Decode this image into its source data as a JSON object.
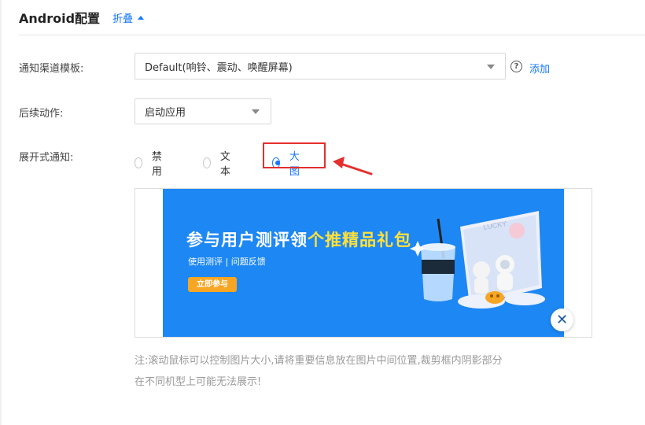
{
  "section": {
    "title": "Android配置",
    "collapse_label": "折叠"
  },
  "channel_template": {
    "label": "通知渠道模板:",
    "value": "Default(响铃、震动、唤醒屏幕)",
    "add_label": "添加",
    "help_icon": "question-circle-icon"
  },
  "follow_action": {
    "label": "后续动作:",
    "value": "启动应用"
  },
  "expand_notification": {
    "label": "展开式通知:",
    "options": [
      "禁用",
      "文本",
      "大图"
    ],
    "selected": "大图"
  },
  "banner": {
    "headline_main": "参与用户测评领",
    "headline_highlight": "个推精品礼包",
    "subline": "使用测评 | 问题反馈",
    "button": "立即参与",
    "card_text": "LUCKY",
    "close_icon": "close-icon"
  },
  "note": {
    "line1": "注:滚动鼠标可以控制图片大小,请将重要信息放在图片中间位置,裁剪框内阴影部分",
    "line2": "在不同机型上可能无法展示!"
  },
  "colors": {
    "accent": "#1677ff",
    "banner_bg": "#1d87f4",
    "highlight_red": "#e3302d",
    "headline_yellow": "#ffe13a",
    "banner_button": "#f7a623"
  }
}
